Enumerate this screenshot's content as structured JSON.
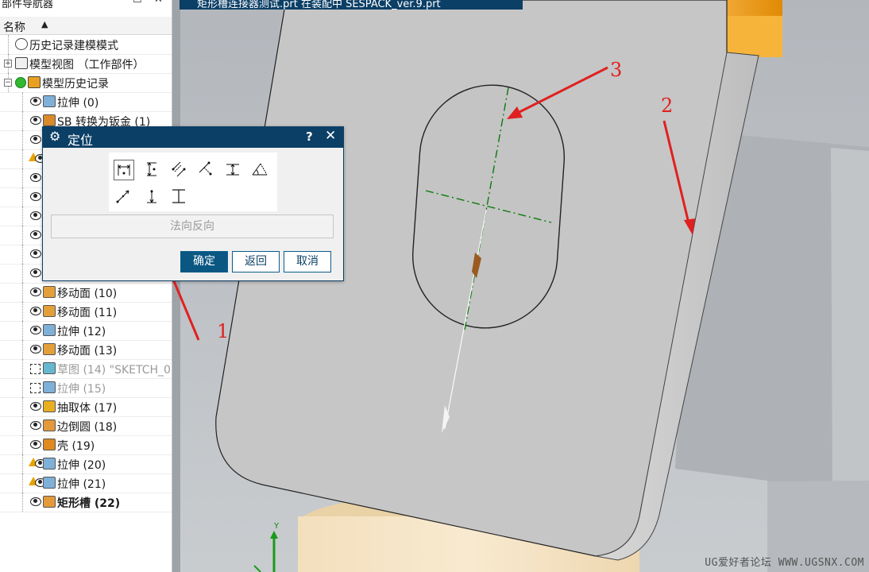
{
  "navigator": {
    "title": "部件导航器",
    "column_name": "名称",
    "rows": [
      {
        "label": "历史记录建模模式",
        "state": "none",
        "icon": "clock-icon"
      },
      {
        "label": "模型视图 （工作部件）",
        "state": "none",
        "icon": "model-views-icon"
      },
      {
        "label": "模型历史记录",
        "state": "none",
        "icon": "history-folder-icon"
      },
      {
        "label": "拉伸 (0)",
        "state": "visible",
        "icon": "extrude-icon"
      },
      {
        "label": "SB 转换为钣金 (1)",
        "state": "visible",
        "icon": "sheetmetal-icon"
      },
      {
        "label": "",
        "state": "visible",
        "icon": "feature-icon"
      },
      {
        "label": "",
        "state": "warning",
        "icon": "feature-icon"
      },
      {
        "label": "",
        "state": "visible",
        "icon": "feature-icon"
      },
      {
        "label": "",
        "state": "visible",
        "icon": "feature-icon"
      },
      {
        "label": "",
        "state": "visible",
        "icon": "feature-icon"
      },
      {
        "label": "",
        "state": "visible",
        "icon": "feature-icon"
      },
      {
        "label": "",
        "state": "visible",
        "icon": "feature-icon"
      },
      {
        "label": "",
        "state": "visible",
        "icon": "feature-icon"
      },
      {
        "label": "移动面 (10)",
        "state": "visible",
        "icon": "move-face-icon"
      },
      {
        "label": "移动面 (11)",
        "state": "visible",
        "icon": "move-face-icon"
      },
      {
        "label": "拉伸 (12)",
        "state": "visible",
        "icon": "extrude-icon"
      },
      {
        "label": "移动面 (13)",
        "state": "visible",
        "icon": "move-face-icon"
      },
      {
        "label": "草图 (14) \"SKETCH_0",
        "state": "hidden",
        "icon": "sketch-icon"
      },
      {
        "label": "拉伸 (15)",
        "state": "hidden",
        "icon": "extrude-icon"
      },
      {
        "label": "抽取体 (17)",
        "state": "visible",
        "icon": "extract-body-icon"
      },
      {
        "label": "边倒圆 (18)",
        "state": "visible",
        "icon": "edge-blend-icon"
      },
      {
        "label": "壳 (19)",
        "state": "visible",
        "icon": "shell-icon"
      },
      {
        "label": "拉伸 (20)",
        "state": "warning",
        "icon": "extrude-icon"
      },
      {
        "label": "拉伸 (21)",
        "state": "warning",
        "icon": "extrude-icon"
      },
      {
        "label": "矩形槽 (22)",
        "state": "visible",
        "icon": "rect-groove-icon"
      }
    ]
  },
  "document_tab": "矩形槽连接器测试.prt 在装配中 SESPACK_ver.9.prt",
  "dialog": {
    "title": "定位",
    "help_glyph": "?",
    "close_glyph": "✕",
    "flip_normal_label": "法向反向",
    "ok_label": "确定",
    "back_label": "返回",
    "cancel_label": "取消",
    "tools": [
      "horizontal-dimension-icon",
      "vertical-dimension-icon",
      "parallel-dimension-icon",
      "perpendicular-dimension-icon",
      "parallel-at-distance-icon",
      "angular-dimension-icon",
      "point-onto-point-icon",
      "point-onto-line-icon",
      "line-onto-line-icon"
    ]
  },
  "annotations": [
    "1",
    "2",
    "3"
  ],
  "axis_label": "Y",
  "watermark": "UG爱好者论坛 WWW.UGSNX.COM",
  "colors": {
    "accent": "#0b3f66",
    "arrow": "#e02020",
    "part_face": "#c7c7c7",
    "orange_part": "#f0a020"
  }
}
